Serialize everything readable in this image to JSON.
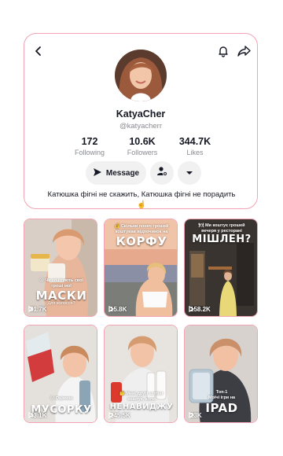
{
  "profile": {
    "username": "KatyaCher",
    "handle": "@katyacherr",
    "bio": "Катюшка фігні не скажить, Катюшка фігні не порадить ☝️",
    "stats": [
      {
        "value": "172",
        "label": "Following"
      },
      {
        "value": "10.6K",
        "label": "Followers"
      },
      {
        "value": "344.7K",
        "label": "Likes"
      }
    ],
    "message_label": "Message"
  },
  "icons": {
    "back": "back-arrow-icon",
    "bell": "bell-icon",
    "share": "share-arrow-icon",
    "send": "send-icon",
    "add_user": "add-user-icon",
    "dropdown": "caret-down-icon",
    "play": "play-icon"
  },
  "colors": {
    "accent_border": "#f2a3b3",
    "button_bg": "#f1f1f2",
    "muted_text": "#8a8b91"
  },
  "videos": [
    {
      "small": "😮 Чи коштують свої\nгроші мої",
      "big": "МАСКИ",
      "caption": "Для волосся?",
      "views": "81.7K"
    },
    {
      "small": "💰 Скільки понеч грошей\nкоштував відпочинок на",
      "big": "КОРФУ",
      "caption": "",
      "views": "15.8K"
    },
    {
      "small": "🍽 Ми коштує грошей\nвечеря у ресторані",
      "big": "МІШЛЕН?",
      "caption": "",
      "views": "158.2K"
    },
    {
      "small": "😮 Оцінюю",
      "big": "МУСОРКУ",
      "caption": "",
      "views": "43.1K"
    },
    {
      "small": "🤔 Мені другі шопінг\nкоштує, коли",
      "big": "НЕНАВИДЖУ",
      "caption": "",
      "views": "245.5K"
    },
    {
      "small": "Топ-1\nМоїчі ігри на",
      "big": "IPAD",
      "caption": "",
      "views": "23K"
    }
  ]
}
